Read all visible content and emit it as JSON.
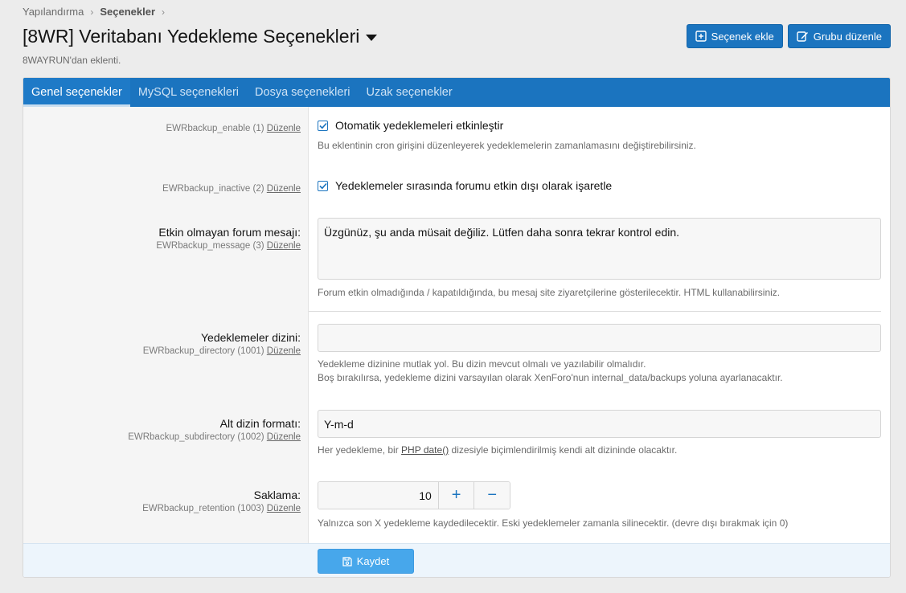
{
  "breadcrumb": {
    "items": [
      "Yapılandırma",
      "Seçenekler"
    ]
  },
  "header": {
    "title": "[8WR] Veritabanı Yedekleme Seçenekleri",
    "subtitle": "8WAYRUN'dan eklenti.",
    "buttons": {
      "add_option": "Seçenek ekle",
      "edit_group": "Grubu düzenle"
    }
  },
  "tabs": [
    {
      "label": "Genel seçenekler",
      "active": true
    },
    {
      "label": "MySQL seçenekleri",
      "active": false
    },
    {
      "label": "Dosya seçenekleri",
      "active": false
    },
    {
      "label": "Uzak seçenekler",
      "active": false
    }
  ],
  "edit_link": "Düzenle",
  "options": {
    "enable": {
      "key": "EWRbackup_enable (1)",
      "checkbox_label": "Otomatik yedeklemeleri etkinleştir",
      "checked": true,
      "hint": "Bu eklentinin cron girişini düzenleyerek yedeklemelerin zamanlamasını değiştirebilirsiniz."
    },
    "inactive": {
      "key": "EWRbackup_inactive (2)",
      "checkbox_label": "Yedeklemeler sırasında forumu etkin dışı olarak işaretle",
      "checked": true
    },
    "message": {
      "label": "Etkin olmayan forum mesajı:",
      "key": "EWRbackup_message (3)",
      "value": "Üzgünüz, şu anda müsait değiliz. Lütfen daha sonra tekrar kontrol edin.",
      "hint": "Forum etkin olmadığında / kapatıldığında, bu mesaj site ziyaretçilerine gösterilecektir. HTML kullanabilirsiniz."
    },
    "directory": {
      "label": "Yedeklemeler dizini:",
      "key": "EWRbackup_directory (1001)",
      "value": "",
      "hint_line1": "Yedekleme dizinine mutlak yol. Bu dizin mevcut olmalı ve yazılabilir olmalıdır.",
      "hint_line2": "Boş bırakılırsa, yedekleme dizini varsayılan olarak XenForo'nun internal_data/backups yoluna ayarlanacaktır."
    },
    "subdirectory": {
      "label": "Alt dizin formatı:",
      "key": "EWRbackup_subdirectory (1002)",
      "value": "Y-m-d",
      "hint_before": "Her yedekleme, bir ",
      "hint_link": "PHP date()",
      "hint_after": " dizesiyle biçimlendirilmiş kendi alt dizininde olacaktır."
    },
    "retention": {
      "label": "Saklama:",
      "key": "EWRbackup_retention (1003)",
      "value": "10",
      "plus": "+",
      "minus": "−",
      "hint": "Yalnızca son X yedekleme kaydedilecektir. Eski yedeklemeler zamanla silinecektir. (devre dışı bırakmak için 0)"
    }
  },
  "footer": {
    "save_label": "Kaydet"
  },
  "colors": {
    "accent": "#1b74bf",
    "save_button": "#47a7eb"
  }
}
